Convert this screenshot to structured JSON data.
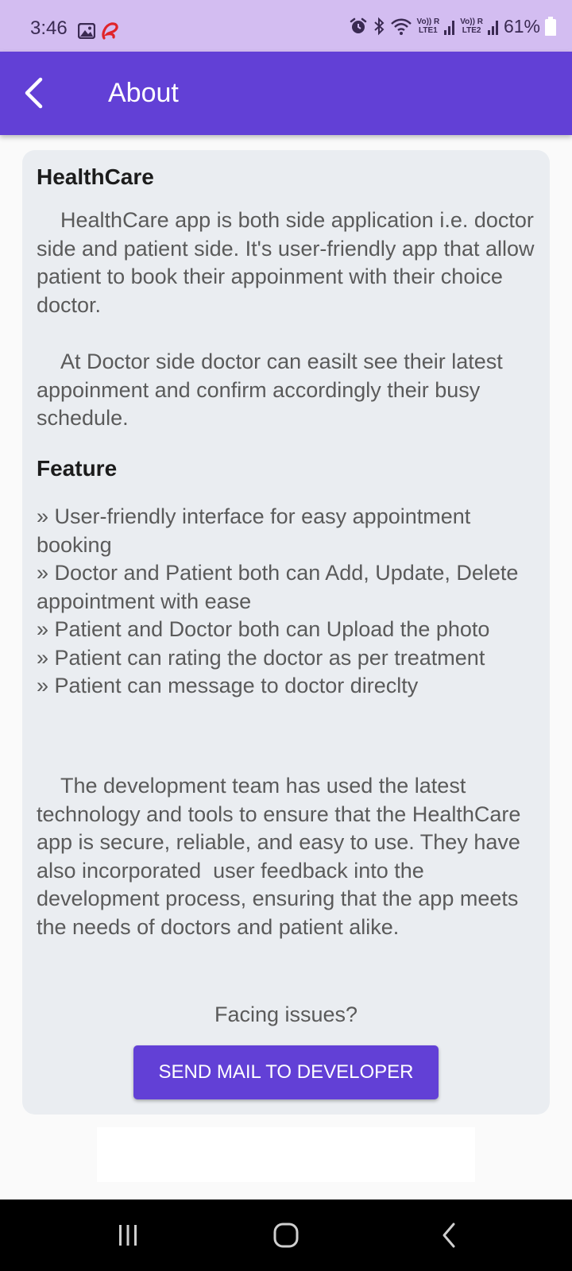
{
  "status_bar": {
    "time": "3:46",
    "sim1": "Vo)) R\nLTE1",
    "sim2": "Vo)) R\nLTE2",
    "battery": "61%",
    "icons": [
      "gallery-icon",
      "airtel-icon",
      "alarm-icon",
      "bluetooth-icon",
      "wifi-icon",
      "signal-icon",
      "signal-icon",
      "battery-icon"
    ]
  },
  "app_bar": {
    "title": "About",
    "back_icon": "back-arrow-icon",
    "color": "#6240d6"
  },
  "about": {
    "heading": "HealthCare",
    "intro": "    HealthCare app is both side application i.e. doctor side and patient side. It's user-friendly app that allow patient to book their appoinment with their choice doctor.",
    "doctor_side": "    At Doctor side doctor can easilt see their latest appoinment and confirm accordingly their busy schedule."
  },
  "feature": {
    "heading": "Feature",
    "items": [
      "» User-friendly interface for easy appointment booking",
      "» Doctor and Patient both can Add, Update, Delete appointment with ease",
      "» Patient and Doctor both can Upload the photo",
      "» Patient can rating the doctor as per treatment",
      "» Patient can message to doctor direclty"
    ]
  },
  "development": {
    "text": "    The development team has used the latest technology and tools to ensure that the HealthCare app is secure, reliable, and easy to use. They have also incorporated  user feedback into the development process, ensuring that the app meets the needs of doctors and patient alike."
  },
  "support": {
    "question": "Facing issues?",
    "button_label": "SEND MAIL TO DEVELOPER"
  },
  "nav_bar": {
    "buttons": [
      "recent-apps-icon",
      "home-icon",
      "back-icon"
    ]
  }
}
